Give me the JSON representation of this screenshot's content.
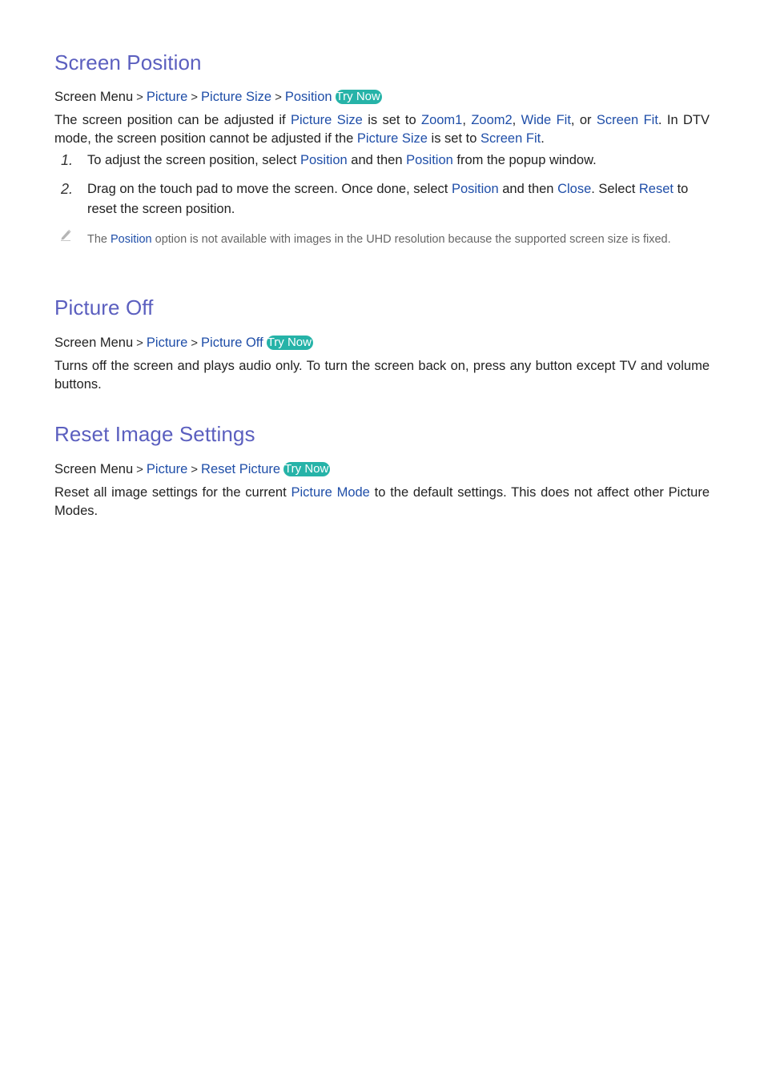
{
  "colors": {
    "heading": "#5b5fbf",
    "link": "#1f4ea8",
    "try_now_bg": "#26b3a8",
    "body_text": "#222222",
    "note_text": "#666666"
  },
  "sections": [
    {
      "title": "Screen Position",
      "breadcrumb": {
        "root": "Screen Menu",
        "separator": ">",
        "items": [
          "Picture",
          "Picture Size",
          "Position"
        ],
        "try_now": "Try Now"
      },
      "description": {
        "p1": "The screen position can be adjusted if ",
        "h1": "Picture Size",
        "p2": " is set to ",
        "h2": "Zoom1",
        "p3": ", ",
        "h3": "Zoom2",
        "p4": ", ",
        "h4": "Wide Fit",
        "p5": ", or ",
        "h5": "Screen Fit",
        "p6": ". In DTV mode, the screen position cannot be adjusted if the ",
        "h6": "Picture Size",
        "p7": " is set to ",
        "h7": "Screen Fit",
        "p8": "."
      },
      "steps": [
        {
          "number": "1.",
          "t1": "To adjust the screen position, select ",
          "h1": "Position",
          "t2": " and then ",
          "h2": "Position",
          "t3": " from the popup window."
        },
        {
          "number": "2.",
          "t1": "Drag on the touch pad to move the screen. Once done, select ",
          "h1": "Position",
          "t2": " and then ",
          "h2": "Close",
          "t3": ". Select ",
          "h3": "Reset",
          "t4": " to reset the screen position."
        }
      ],
      "note": {
        "icon": "pencil-icon",
        "t1": "The ",
        "h1": "Position",
        "t2": " option is not available with images in the UHD resolution because the supported screen size is fixed."
      }
    },
    {
      "title": "Picture Off",
      "breadcrumb": {
        "root": "Screen Menu",
        "separator": ">",
        "items": [
          "Picture",
          "Picture Off"
        ],
        "try_now": "Try Now"
      },
      "description": {
        "p1": "Turns off the screen and plays audio only. To turn the screen back on, press any button except TV and volume buttons."
      }
    },
    {
      "title": "Reset Image Settings",
      "breadcrumb": {
        "root": "Screen Menu",
        "separator": ">",
        "items": [
          "Picture",
          "Reset Picture"
        ],
        "try_now": "Try Now"
      },
      "description": {
        "p1": "Reset all image settings for the current ",
        "h1": "Picture Mode",
        "p2": " to the default settings. This does not affect other Picture Modes."
      }
    }
  ]
}
